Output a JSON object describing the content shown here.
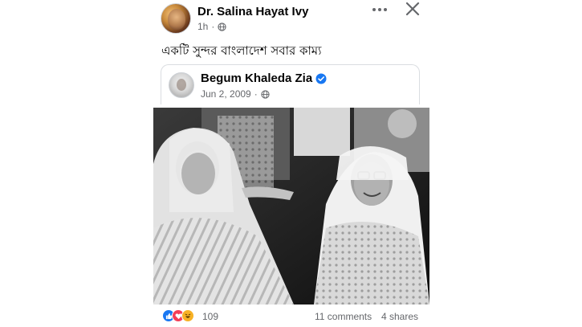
{
  "post": {
    "author": "Dr. Salina Hayat Ivy",
    "time": "1h",
    "privacy_icon": "globe-icon",
    "text": "একটি সুন্দর বাংলাদেশ সবার কাম্য"
  },
  "shared": {
    "author": "Begum Khaleda Zia",
    "verified_icon": "verified-badge-icon",
    "date": "Jun 2, 2009",
    "privacy_icon": "globe-icon",
    "photo_alt": "Black and white photo of two smiling women in saris"
  },
  "footer": {
    "reaction_icons": [
      "like-icon",
      "love-icon",
      "haha-icon"
    ],
    "reaction_count": "109",
    "comments": "11 comments",
    "shares": "4 shares"
  },
  "colors": {
    "text": "#050505",
    "secondary": "#65676b",
    "verified": "#1877f2",
    "like": "#1877f2",
    "love": "#f33e58",
    "haha": "#f7b125",
    "card_border": "#dadde1"
  }
}
